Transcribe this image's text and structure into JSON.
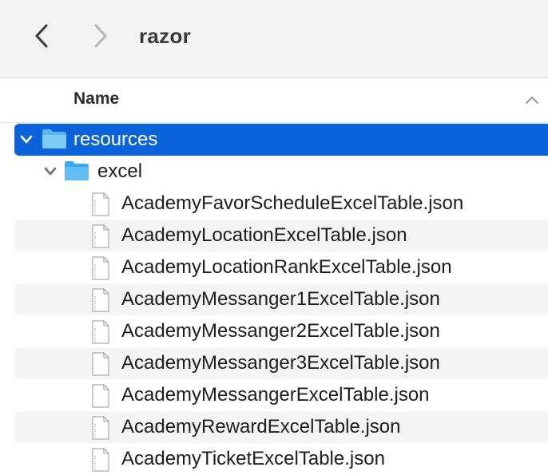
{
  "window": {
    "title": "razor"
  },
  "columns": {
    "name_header": "Name"
  },
  "icons": {
    "back": "chevron-left-icon",
    "forward": "chevron-right-icon",
    "sort": "chevron-up-icon",
    "folder": "folder-icon",
    "file": "document-icon",
    "disclosure_open": "disclosure-down-icon"
  },
  "colors": {
    "selection": "#0a63da",
    "folder": "#5ab8f2",
    "alt_row": "#f4f4f5"
  },
  "tree": {
    "root_folder": "resources",
    "sub_folder": "excel",
    "files": [
      "AcademyFavorScheduleExcelTable.json",
      "AcademyLocationExcelTable.json",
      "AcademyLocationRankExcelTable.json",
      "AcademyMessanger1ExcelTable.json",
      "AcademyMessanger2ExcelTable.json",
      "AcademyMessanger3ExcelTable.json",
      "AcademyMessangerExcelTable.json",
      "AcademyRewardExcelTable.json",
      "AcademyTicketExcelTable.json"
    ]
  }
}
